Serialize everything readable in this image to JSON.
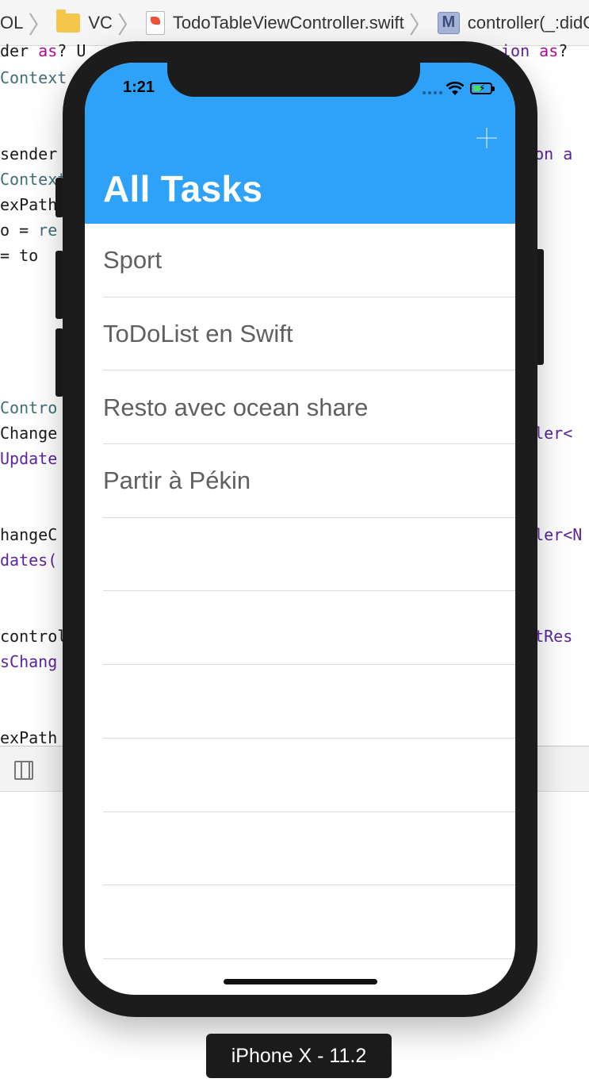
{
  "jumpbar": {
    "items": [
      {
        "label": "OL"
      },
      {
        "label": "VC"
      },
      {
        "label": "TodoTableViewController.swift"
      },
      {
        "label": "controller(_:didCh"
      }
    ],
    "m_icon_letter": "M"
  },
  "code": {
    "lines": [
      {
        "a": "der ",
        "b": "as",
        "c": "? U",
        "d": "ion ",
        "e": "as",
        "f": "?"
      },
      {
        "a": "Context"
      },
      {
        "a": "sender",
        "right_a": "tion a"
      },
      {
        "a": "Context"
      },
      {
        "a": "exPath"
      },
      {
        "a": "o = ",
        "b": "re"
      },
      {
        "a": " = to"
      },
      {
        "a": "Contro"
      },
      {
        "a": "Change",
        "right_a": "oller<"
      },
      {
        "a": "Update"
      },
      {
        "a": "hangeC",
        "right_a": "oller<N"
      },
      {
        "a": "dates("
      },
      {
        "a": "control",
        "right_a": "estRes"
      },
      {
        "a": "sChang"
      },
      {
        "a": "exPath"
      }
    ]
  },
  "simulator": {
    "status_time": "1:21",
    "title": "All Tasks",
    "tasks": [
      {
        "label": "Sport"
      },
      {
        "label": "ToDoList en Swift"
      },
      {
        "label": "Resto avec ocean share"
      },
      {
        "label": "Partir à Pékin"
      },
      {
        "label": ""
      },
      {
        "label": ""
      },
      {
        "label": ""
      },
      {
        "label": ""
      },
      {
        "label": ""
      },
      {
        "label": ""
      }
    ],
    "add_icon": "plus-icon",
    "header_color": "#2ea1f8",
    "battery_color": "#4cd964"
  },
  "device_label": "iPhone X - 11.2"
}
